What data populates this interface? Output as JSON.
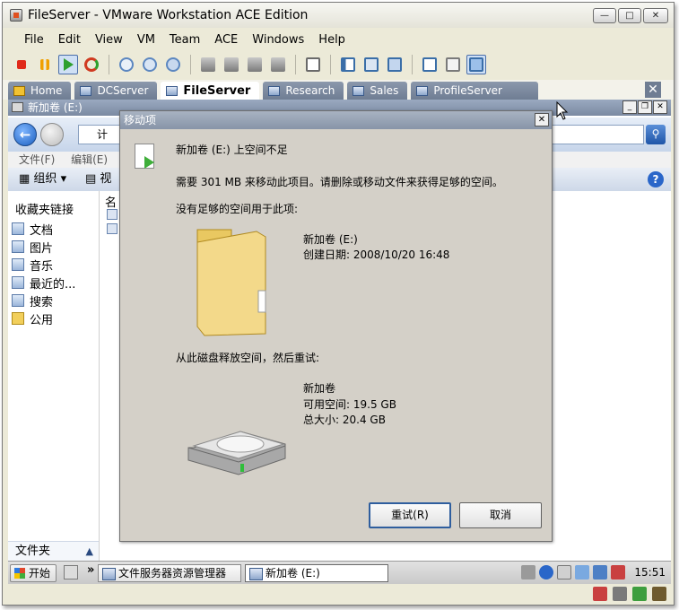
{
  "window": {
    "title": "FileServer - VMware Workstation ACE Edition",
    "controls": [
      "min",
      "max",
      "close"
    ]
  },
  "menu": [
    "File",
    "Edit",
    "View",
    "VM",
    "Team",
    "ACE",
    "Windows",
    "Help"
  ],
  "toolbar": {
    "buttons": [
      {
        "name": "power-off-icon",
        "color": "#e02a1a"
      },
      {
        "name": "suspend-icon",
        "color": "#f0a000"
      },
      {
        "name": "power-on-icon",
        "color": "#2ea02e"
      },
      {
        "name": "reset-icon",
        "color": "#d03a20"
      },
      {
        "name": "snapshot-icon",
        "color": "#5c87c0"
      },
      {
        "name": "revert-snapshot-icon",
        "color": "#5c87c0"
      },
      {
        "name": "snapshot-manager-icon",
        "color": "#5c87c0"
      },
      {
        "name": "team-power-off-icon",
        "color": "#7a7a7a"
      },
      {
        "name": "team-power-on-icon",
        "color": "#7a7a7a"
      },
      {
        "name": "team-suspend-icon",
        "color": "#7a7a7a"
      },
      {
        "name": "team-reset-icon",
        "color": "#7a7a7a"
      },
      {
        "name": "capture-icon",
        "color": "#7a7a7a"
      },
      {
        "name": "sidebar-icon",
        "color": "#3a6ea8"
      },
      {
        "name": "fullscreen-icon",
        "color": "#3a6ea8"
      },
      {
        "name": "quick-switch-icon",
        "color": "#3a6ea8"
      },
      {
        "name": "console-view-icon",
        "color": "#3a6ea8"
      },
      {
        "name": "summary-view-icon",
        "color": "#3a6ea8"
      },
      {
        "name": "appliance-view-icon",
        "color": "#3a6ea8"
      }
    ]
  },
  "tabs": [
    {
      "label": "Home",
      "active": false,
      "icon": "home-icon"
    },
    {
      "label": "DCServer",
      "active": false,
      "icon": "vm-icon"
    },
    {
      "label": "FileServer",
      "active": true,
      "icon": "vm-icon"
    },
    {
      "label": "Research",
      "active": false,
      "icon": "vm-icon"
    },
    {
      "label": "Sales",
      "active": false,
      "icon": "vm-icon"
    },
    {
      "label": "ProfileServer",
      "active": false,
      "icon": "vm-icon"
    }
  ],
  "explorer": {
    "title": "新加卷 (E:)",
    "address": "计",
    "menu": [
      "文件(F)",
      "编辑(E)"
    ],
    "organize": "组织",
    "views": "视",
    "column_header": "名",
    "nav_header": "收藏夹链接",
    "nav_items": [
      "文档",
      "图片",
      "音乐",
      "最近的...",
      "搜索",
      "公用"
    ],
    "folders_label": "文件夹"
  },
  "dialog": {
    "title": "移动项",
    "heading": "新加卷 (E:) 上空间不足",
    "message": "需要 301 MB 来移动此项目。请删除或移动文件来获得足够的空间。",
    "no_space_label": "没有足够的空间用于此项:",
    "item_name": "新加卷 (E:)",
    "item_created": "创建日期: 2008/10/20 16:48",
    "free_up_label": "从此磁盘释放空间，然后重试:",
    "drive_name": "新加卷",
    "drive_free": "可用空间: 19.5 GB",
    "drive_total": "总大小: 20.4 GB",
    "retry": "重试(R)",
    "cancel": "取消"
  },
  "taskbar": {
    "start": "开始",
    "task1": "文件服务器资源管理器",
    "task2": "新加卷  (E:)",
    "clock": "15:51"
  }
}
